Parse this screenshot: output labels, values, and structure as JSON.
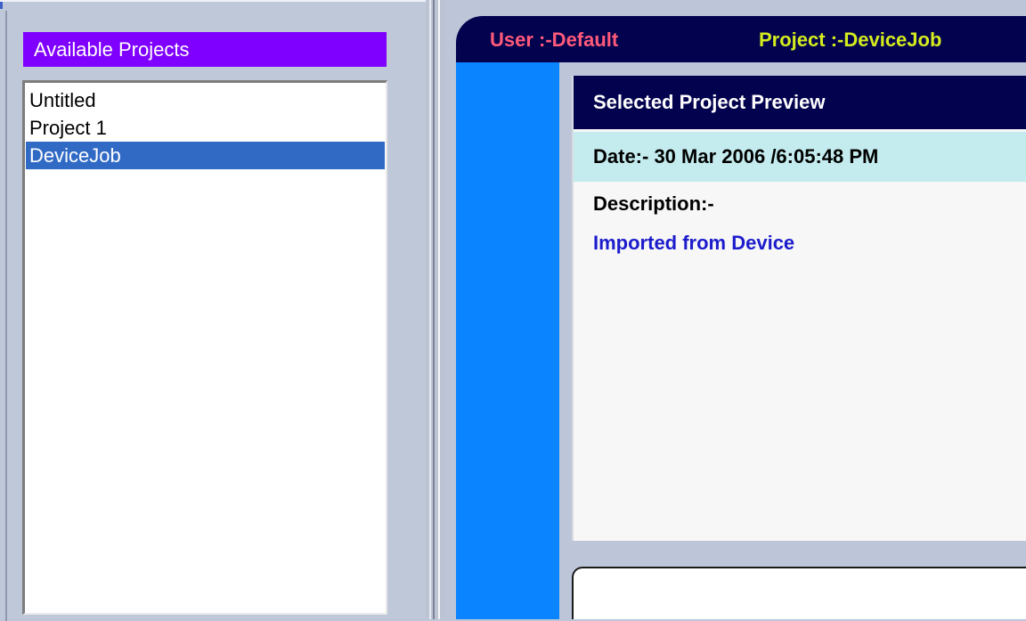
{
  "left_panel": {
    "heading": "Available Projects",
    "projects": [
      {
        "label": "Untitled",
        "selected": false
      },
      {
        "label": "Project 1",
        "selected": false
      },
      {
        "label": "DeviceJob",
        "selected": true
      }
    ]
  },
  "header": {
    "user_text": "User :-Default",
    "project_text": "Project :-DeviceJob"
  },
  "preview": {
    "title": "Selected Project Preview",
    "date_text": "Date:- 30 Mar 2006 /6:05:48 PM",
    "description_label": "Description:-",
    "description_value": "Imported from Device"
  },
  "colors": {
    "heading_bg": "#7f00ff",
    "selection_bg": "#316ac5",
    "header_bg": "#03024e",
    "user_text": "#ff5a7a",
    "project_text": "#d4ec1e",
    "sidebar_blue": "#0a84ff",
    "date_bg": "#c4ecee",
    "description_text": "#1c1ccc"
  }
}
